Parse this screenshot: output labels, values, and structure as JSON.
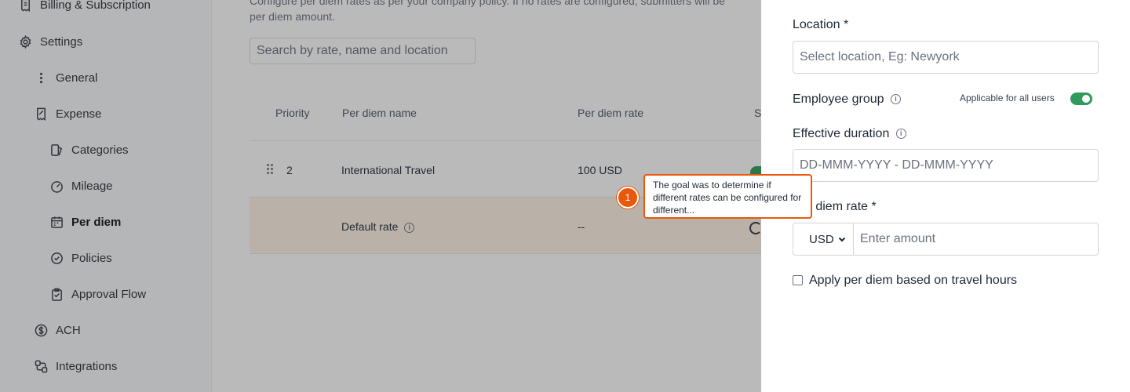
{
  "sidebar": {
    "items": [
      {
        "label": "Billing & Subscription",
        "icon": "receipt-icon"
      },
      {
        "label": "Settings",
        "icon": "gear-icon"
      },
      {
        "label": "General",
        "icon": "more-vertical-icon"
      },
      {
        "label": "Expense",
        "icon": "receipt-icon"
      },
      {
        "label": "Categories",
        "icon": "category-icon"
      },
      {
        "label": "Mileage",
        "icon": "gauge-icon"
      },
      {
        "label": "Per diem",
        "icon": "calendar-icon"
      },
      {
        "label": "Policies",
        "icon": "check-circle-icon"
      },
      {
        "label": "Approval Flow",
        "icon": "clipboard-check-icon"
      },
      {
        "label": "ACH",
        "icon": "dollar-circle-icon"
      },
      {
        "label": "Integrations",
        "icon": "integrations-icon"
      }
    ]
  },
  "main": {
    "description_line1": "Configure per diem rates as per your company policy. If no rates are configured, submitters will be",
    "description_line2": "per diem amount.",
    "search_placeholder": "Search by rate, name and location",
    "columns": {
      "priority": "Priority",
      "name": "Per diem name",
      "rate": "Per diem rate",
      "status": "St"
    },
    "rows": [
      {
        "priority": "2",
        "name": "International Travel",
        "rate": "100 USD"
      },
      {
        "priority": "",
        "name": "Default rate",
        "rate": "--"
      }
    ]
  },
  "drawer": {
    "location_label": "Location *",
    "location_placeholder": "Select location, Eg: Newyork",
    "employee_group_label": "Employee group",
    "applicable_label": "Applicable for all users",
    "effective_duration_label": "Effective duration",
    "duration_placeholder": "DD-MMM-YYYY - DD-MMM-YYYY",
    "rate_label": "Per diem rate *",
    "currency": "USD",
    "amount_placeholder": "Enter amount",
    "travel_hours_label": "Apply per diem based on travel hours"
  },
  "annotation": {
    "number": "1",
    "text": "The goal was to determine if different rates can be configured for different..."
  },
  "colors": {
    "accent_green": "#2f9b5a",
    "annotation_orange": "#e8590c",
    "highlight_row": "#fff4e6"
  }
}
